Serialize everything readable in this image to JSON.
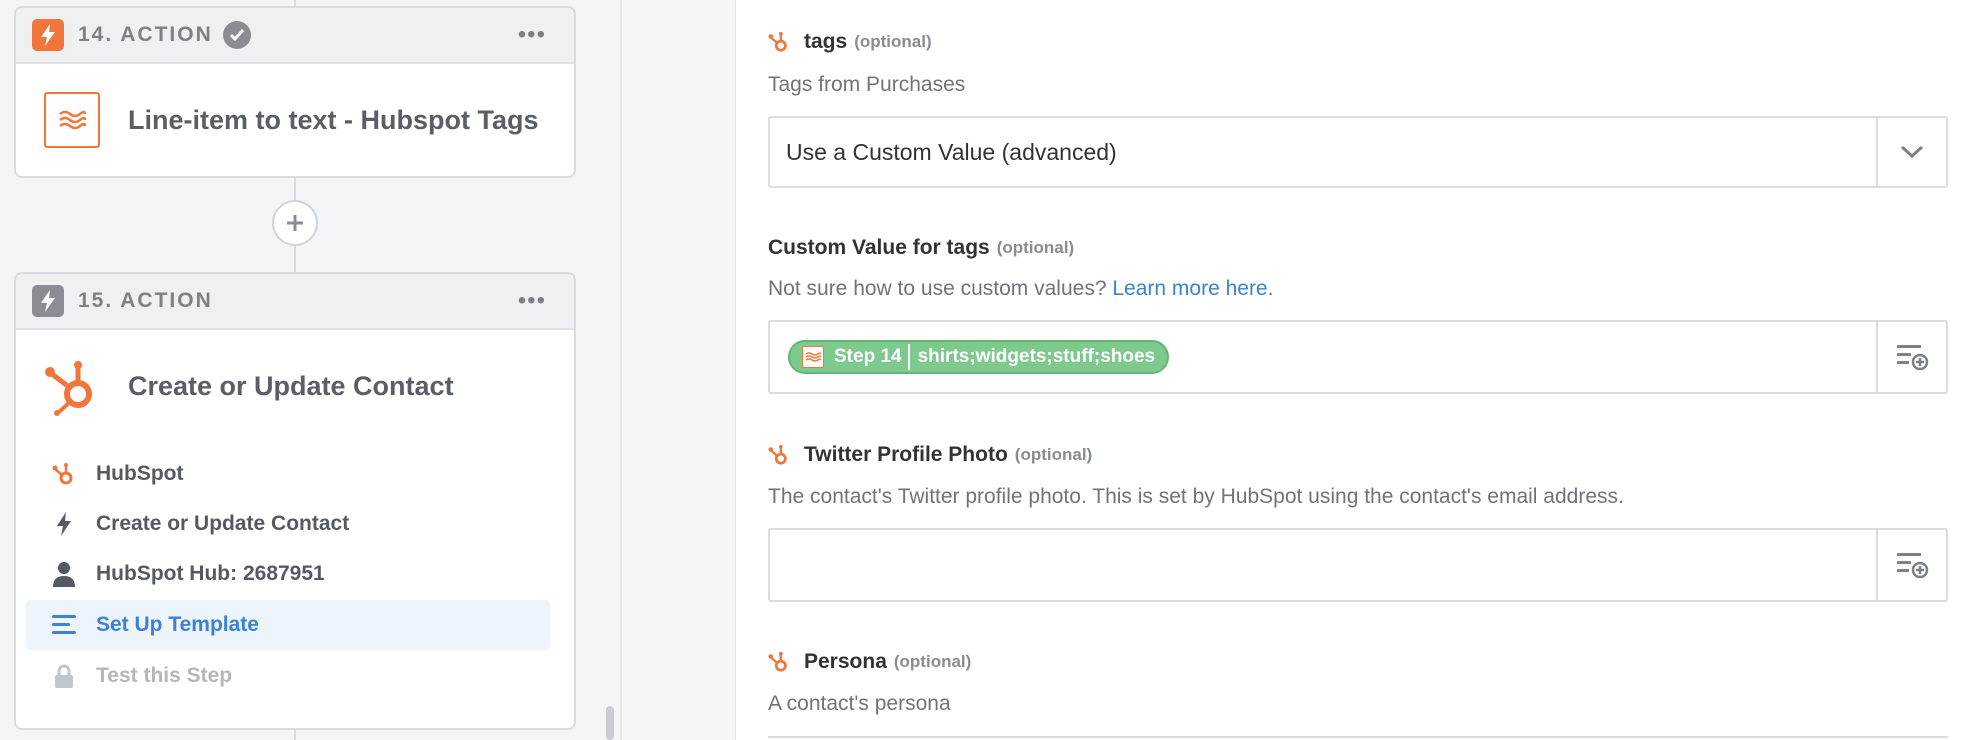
{
  "workflow": {
    "step14": {
      "header": "14. ACTION",
      "title": "Line-item to text - Hubspot Tags"
    },
    "step15": {
      "header": "15. ACTION",
      "title": "Create or Update Contact",
      "items": [
        {
          "label": "HubSpot",
          "icon": "hubspot-icon"
        },
        {
          "label": "Create or Update Contact",
          "icon": "bolt-icon"
        },
        {
          "label": "HubSpot Hub: 2687951",
          "icon": "user-icon"
        },
        {
          "label": "Set Up Template",
          "icon": "list-icon",
          "active": true
        },
        {
          "label": "Test this Step",
          "icon": "lock-icon",
          "locked": true
        }
      ]
    }
  },
  "form": {
    "tags": {
      "label": "tags",
      "optional": "(optional)",
      "help": "Tags from Purchases",
      "selected": "Use a Custom Value (advanced)"
    },
    "custom_tags": {
      "label": "Custom Value for tags",
      "optional": "(optional)",
      "help_prefix": "Not sure how to use custom values?",
      "help_link": "Learn more here",
      "help_suffix": ".",
      "pill_step": "Step 14",
      "pill_value": "shirts;widgets;stuff;shoes"
    },
    "twitter_photo": {
      "label": "Twitter Profile Photo",
      "optional": "(optional)",
      "help": "The contact's Twitter profile photo. This is set by HubSpot using the contact's email address.",
      "value": ""
    },
    "persona": {
      "label": "Persona",
      "optional": "(optional)",
      "help": "A contact's persona"
    }
  },
  "colors": {
    "accent_orange": "#f0763b",
    "link_blue": "#3b82d6",
    "pill_green": "#7ec98d"
  }
}
